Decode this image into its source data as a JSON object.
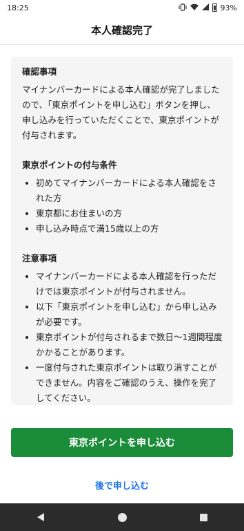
{
  "status_bar": {
    "time": "18:25",
    "battery": "93%"
  },
  "header": {
    "title": "本人確認完了"
  },
  "confirmation": {
    "title": "確認事項",
    "body": "マイナンバーカードによる本人確認が完了しましたので、「東京ポイントを申し込む」ボタンを押し、申し込みを行っていただくことで、東京ポイントが付与されます。"
  },
  "conditions": {
    "title": "東京ポイントの付与条件",
    "items": [
      "初めてマイナンバーカードによる本人確認をされた方",
      "東京都にお住まいの方",
      "申し込み時点で満15歳以上の方"
    ]
  },
  "notes": {
    "title": "注意事項",
    "items": [
      "マイナンバーカードによる本人確認を行っただけでは東京ポイントが付与されません。",
      "以下「東京ポイントを申し込む」から申し込みが必要です。",
      "東京ポイントが付与されるまで数日〜1週間程度かかることがあります。",
      "一度付与された東京ポイントは取り消すことができません。内容をご確認のうえ、操作を完了してください。"
    ]
  },
  "actions": {
    "apply_label": "東京ポイントを申し込む",
    "later_label": "後で申し込む"
  },
  "colors": {
    "primary_green": "#1a8c3a",
    "link_blue": "#1a73e8",
    "card_background": "#f5f5f5",
    "nav_bar": "#2b2b2b"
  },
  "icons": {
    "status": [
      "vibrate-icon",
      "wifi-icon",
      "signal-icon",
      "battery-icon"
    ],
    "navigation": [
      "back-icon",
      "home-icon",
      "recents-icon"
    ]
  }
}
